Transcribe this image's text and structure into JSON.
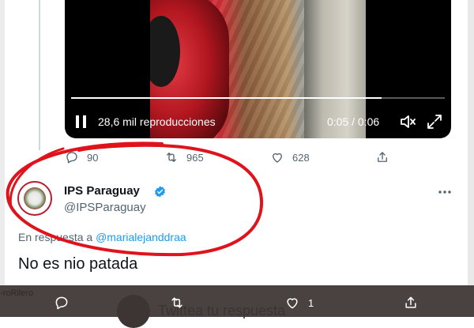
{
  "video": {
    "views": "28,6 mil reproducciones",
    "time": "0:05 / 0:06",
    "progress": 0.83
  },
  "actions": {
    "replies": "90",
    "retweets": "965",
    "likes": "628"
  },
  "reply_tweet": {
    "display_name": "IPS Paraguay",
    "handle": "@IPSParaguay",
    "reply_prefix": "En respuesta a",
    "reply_to": "@marialejanddraa",
    "text": "No es nio patada"
  },
  "bottom_bar": {
    "like_count": "1",
    "ghost_text": "Twittea tu respuesta",
    "ghost_left": "-roRilero"
  },
  "colors": {
    "accent": "#1d9bf0",
    "annotation": "#e0121c",
    "bottom_bar": "#4a4241"
  },
  "icons": [
    "pause-icon",
    "mute-icon",
    "fullscreen-icon",
    "reply-icon",
    "retweet-icon",
    "like-icon",
    "share-icon",
    "verified-icon",
    "more-icon"
  ]
}
